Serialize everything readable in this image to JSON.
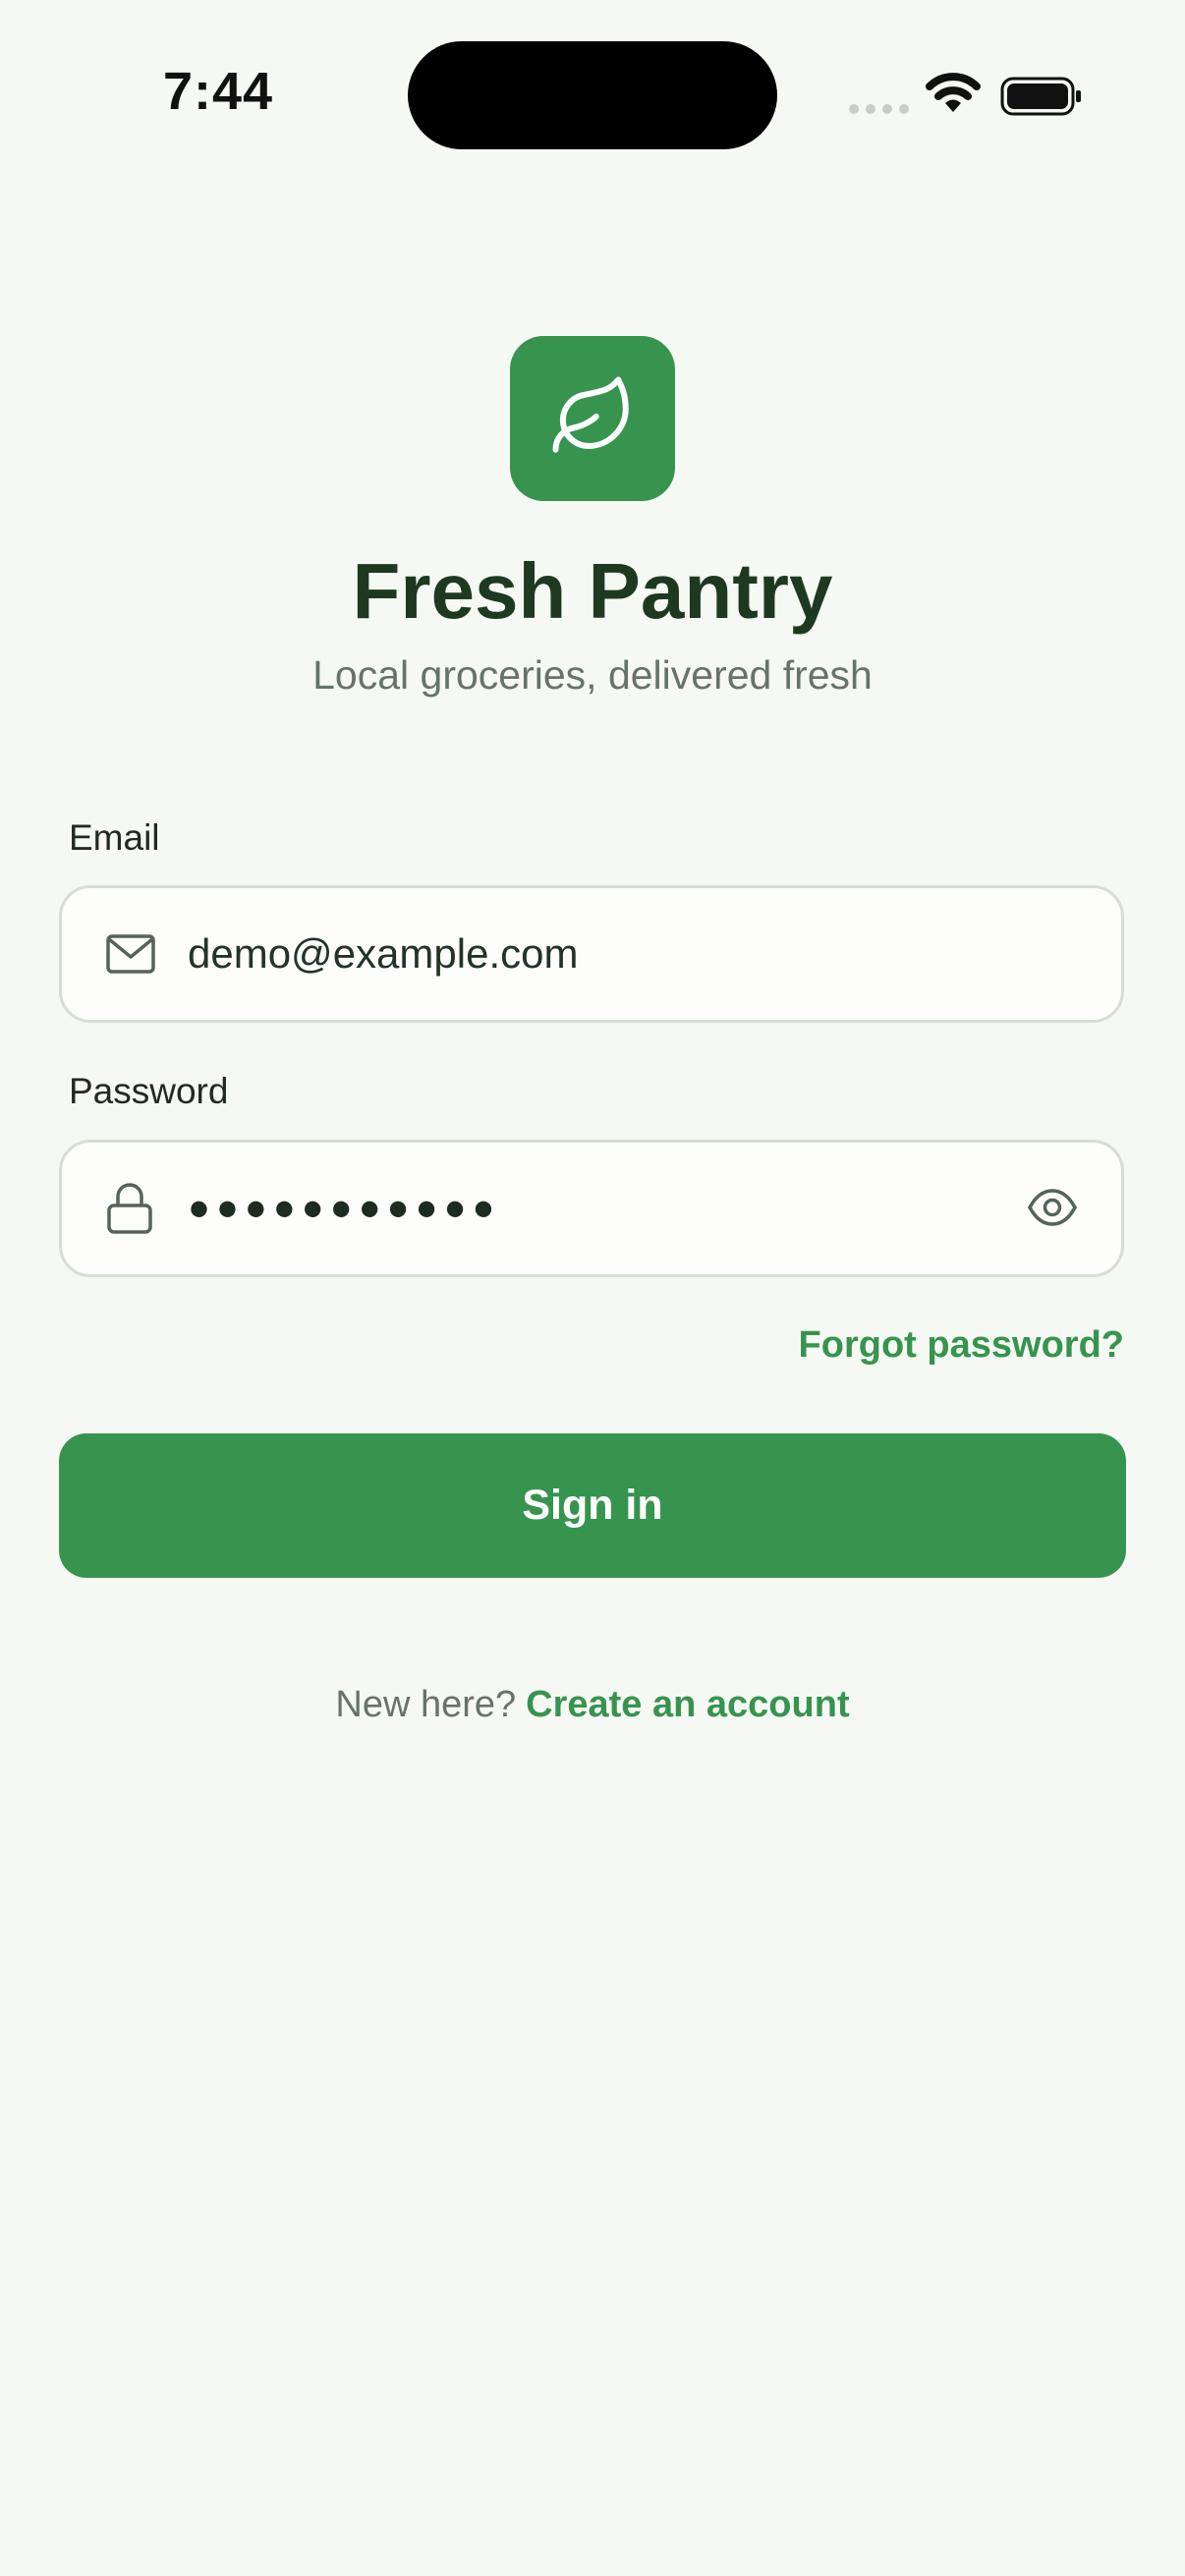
{
  "status_bar": {
    "time": "7:44"
  },
  "app": {
    "title": "Fresh Pantry",
    "tagline": "Local groceries, delivered fresh",
    "logo_icon": "leaf-icon",
    "accent_color": "#36944e"
  },
  "form": {
    "email": {
      "label": "Email",
      "value": "demo@example.com",
      "icon": "mail-icon"
    },
    "password": {
      "label": "Password",
      "masked_value": "●●●●●●●●●●●",
      "icon": "lock-icon",
      "toggle_icon": "eye-icon"
    },
    "forgot_label": "Forgot password?",
    "submit_label": "Sign in"
  },
  "footer": {
    "prompt": "New here?",
    "link": "Create an account"
  }
}
